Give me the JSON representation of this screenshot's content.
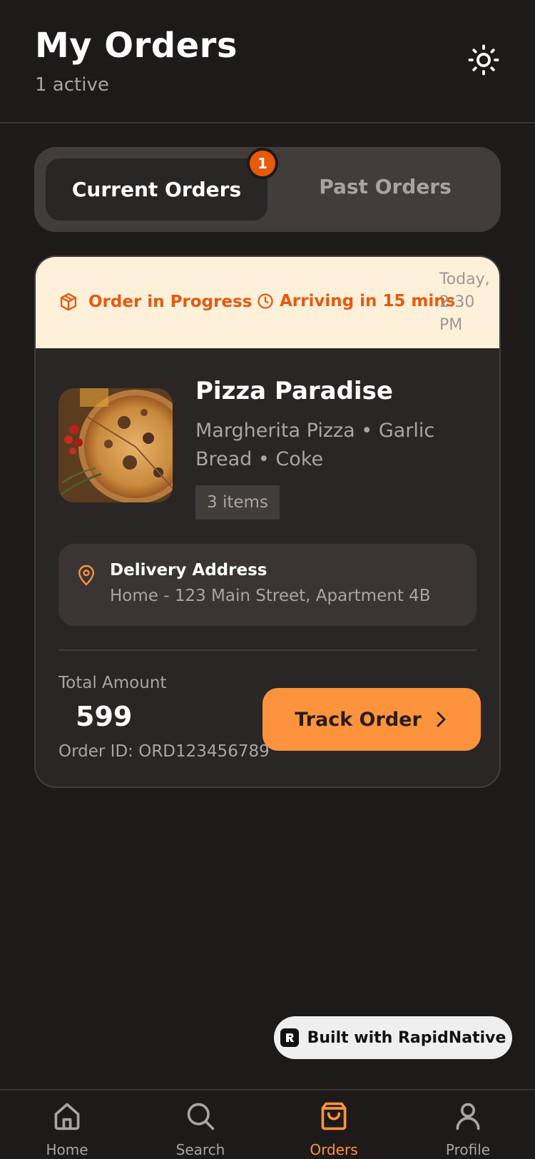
{
  "header": {
    "title": "My Orders",
    "subtitle": "1 active",
    "theme_icon": "sun-icon"
  },
  "tabs": {
    "current_label": "Current Orders",
    "past_label": "Past Orders",
    "current_badge": "1",
    "active": "current"
  },
  "order": {
    "status_label": "Order in Progress",
    "eta_label": "Arriving in 15 mins",
    "time": "Today, 2:30 PM",
    "restaurant": "Pizza Paradise",
    "items_text": "Margherita Pizza • Garlic Bread • Coke",
    "items_count": "3 items",
    "address_title": "Delivery Address",
    "address_text": "Home - 123 Main Street, Apartment 4B",
    "total_label": "Total Amount",
    "total_value": "599",
    "order_id": "Order ID: ORD123456789",
    "track_label": "Track Order"
  },
  "built_with": "Built with RapidNative",
  "nav": {
    "items": [
      {
        "label": "Home",
        "icon": "home-icon"
      },
      {
        "label": "Search",
        "icon": "search-icon"
      },
      {
        "label": "Orders",
        "icon": "shopping-bag-icon"
      },
      {
        "label": "Profile",
        "icon": "user-icon"
      }
    ],
    "active": "Orders"
  },
  "colors": {
    "background": "#1e1a19",
    "accent": "#fd933d",
    "status_orange": "#e8590c",
    "status_bg": "#fff0da",
    "card": "#2a2625"
  }
}
